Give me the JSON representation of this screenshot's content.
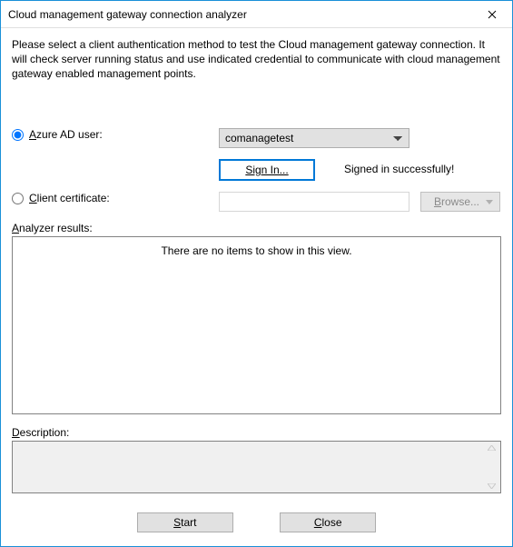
{
  "window": {
    "title": "Cloud management gateway connection analyzer"
  },
  "instructions": "Please select a client authentication method to test the Cloud management gateway connection. It will check server running status and use indicated credential to communicate with cloud management gateway enabled management points.",
  "auth": {
    "azure_ad_label_key": "A",
    "azure_ad_label_rest": "zure AD user:",
    "azure_ad_selected": "comanagetest",
    "sign_in_label": "Sign In...",
    "sign_in_status": "Signed in successfully!",
    "client_cert_label_key": "C",
    "client_cert_label_rest": "lient certificate:",
    "client_cert_value": "",
    "browse_label_key": "B",
    "browse_label_rest": "rowse..."
  },
  "results": {
    "label_key": "A",
    "label_rest": "nalyzer results:",
    "empty_message": "There are no items to show in this view."
  },
  "description": {
    "label_key": "D",
    "label_rest": "escription:"
  },
  "buttons": {
    "start_key": "S",
    "start_rest": "tart",
    "close_key": "C",
    "close_rest": "lose"
  }
}
